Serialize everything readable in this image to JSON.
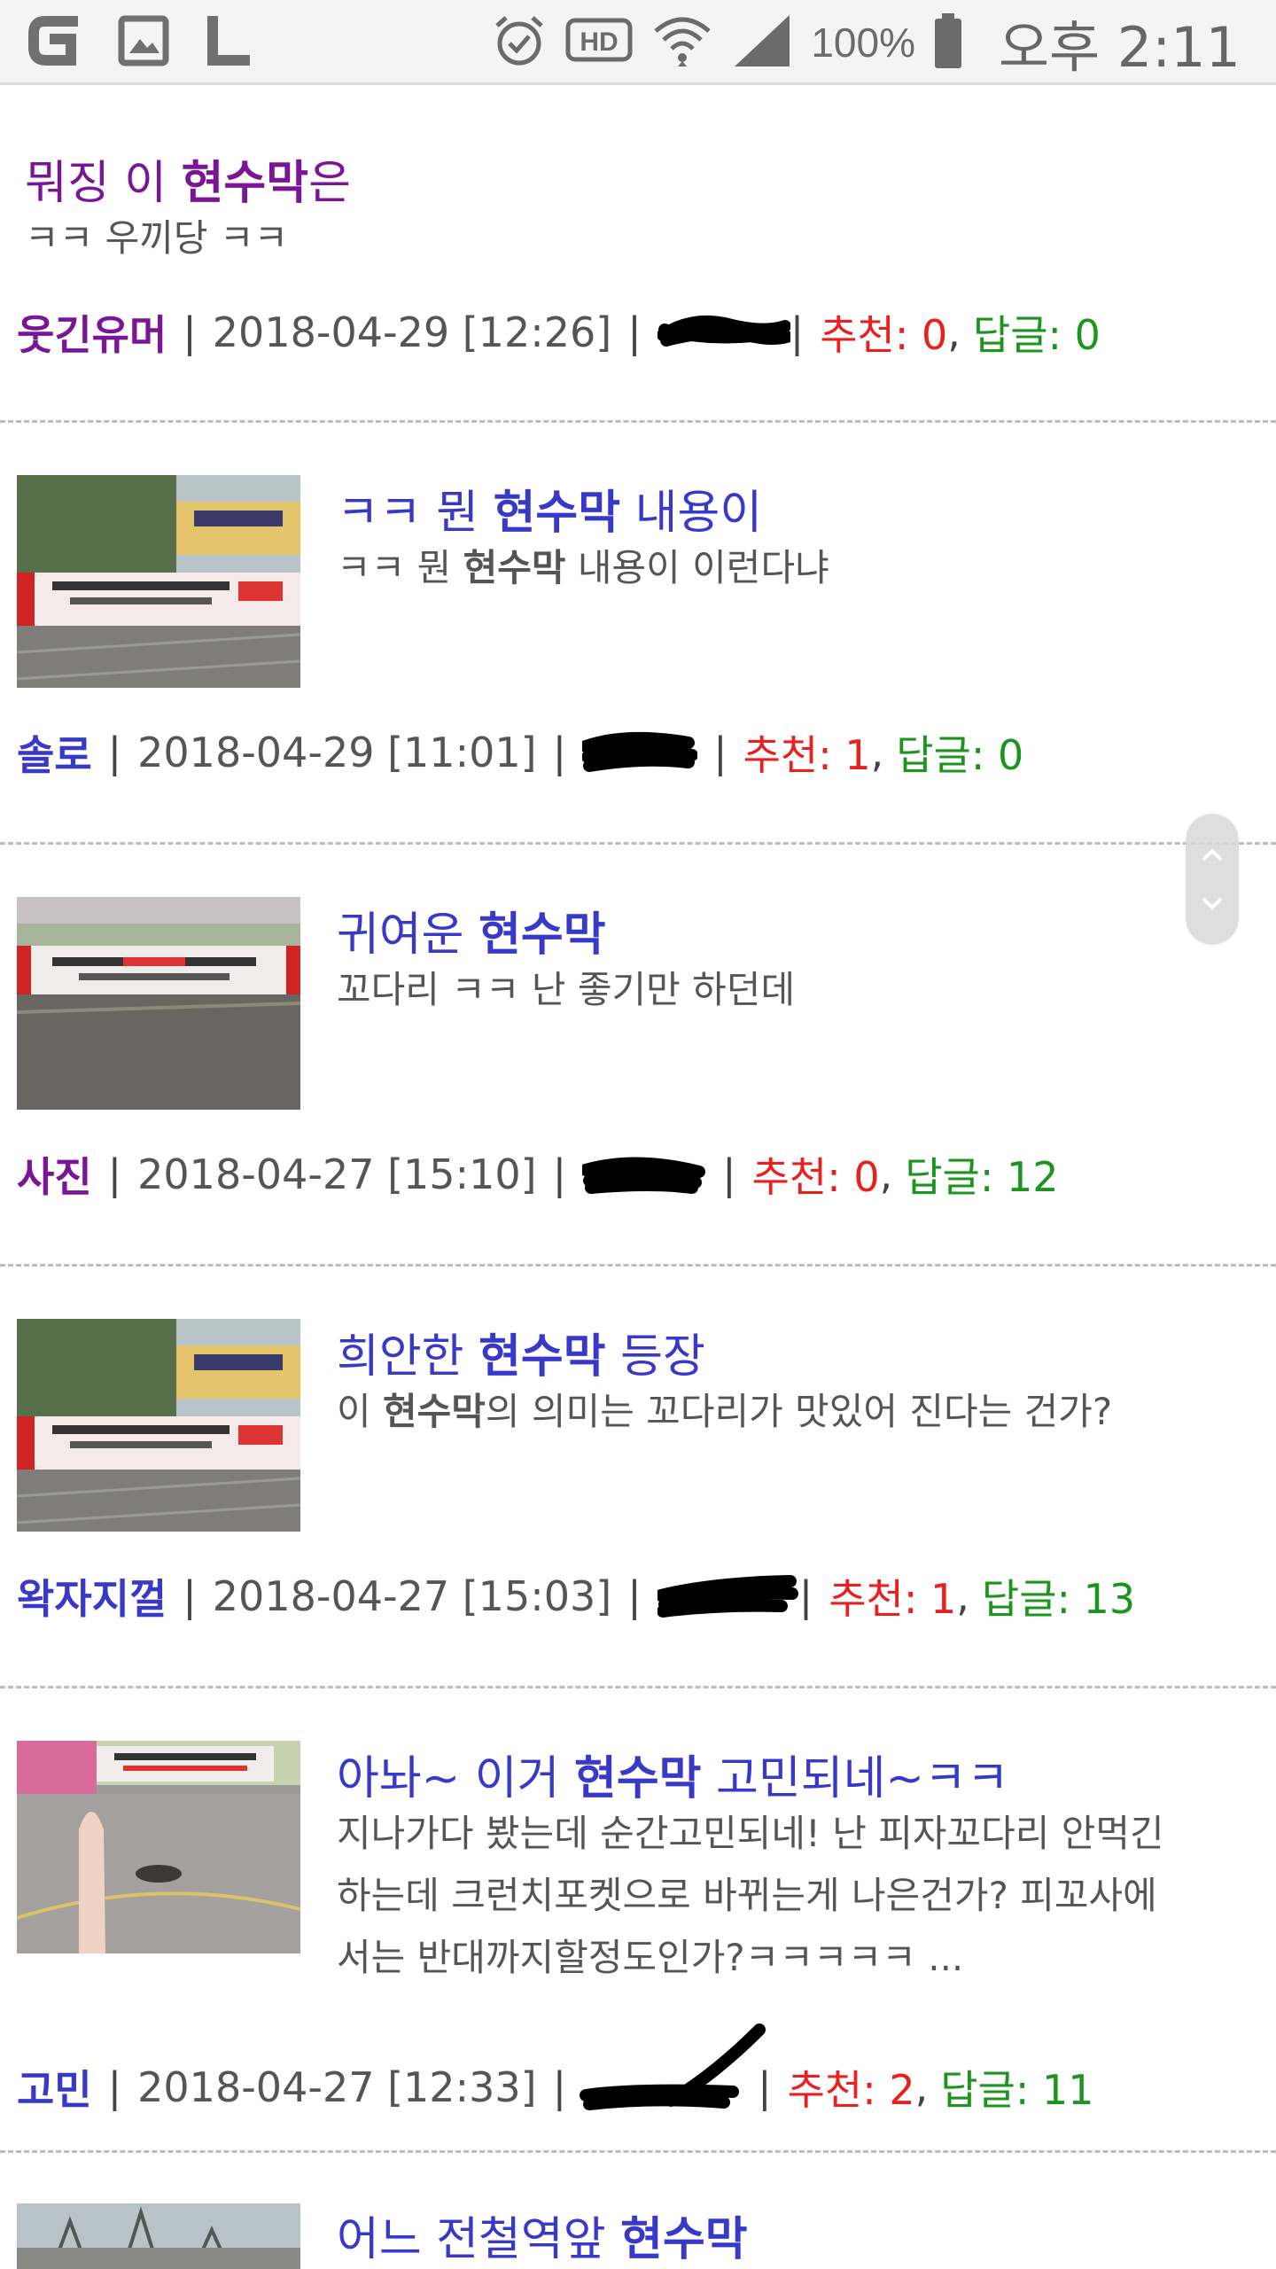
{
  "status_bar": {
    "battery": "100%",
    "time": "오후 2:11",
    "left_icons": [
      "g-app-icon",
      "gallery-icon",
      "l-app-icon"
    ],
    "right_icons": [
      "alarm-icon",
      "hd-icon",
      "wifi-icon",
      "signal-icon",
      "battery-icon"
    ]
  },
  "posts": [
    {
      "title_pre": "뭐징 이 ",
      "title_bold": "현수막",
      "title_post": "은",
      "snippet": "ㅋㅋ 우끼당 ㅋㅋ",
      "author": "웃긴유머",
      "date": "2018-04-29 [12:26]",
      "rec_label": "추천: ",
      "rec_value": "0",
      "reply_label": "답글: ",
      "reply_value": "0",
      "has_thumb": false
    },
    {
      "title_pre": "ㅋㅋ 뭔 ",
      "title_bold": "현수막",
      "title_post": " 내용이",
      "snippet_pre": "ㅋㅋ 뭔 ",
      "snippet_bold": "현수막",
      "snippet_post": " 내용이 이런다냐",
      "author": "솔로",
      "date": "2018-04-29 [11:01]",
      "rec_label": "추천: ",
      "rec_value": "1",
      "reply_label": "답글: ",
      "reply_value": "0",
      "has_thumb": true
    },
    {
      "title_pre": "귀여운 ",
      "title_bold": "현수막",
      "title_post": "",
      "snippet": "꼬다리 ㅋㅋ 난 좋기만 하던데",
      "author": "사진",
      "date": "2018-04-27 [15:10]",
      "rec_label": "추천: ",
      "rec_value": "0",
      "reply_label": "답글: ",
      "reply_value": "12",
      "has_thumb": true
    },
    {
      "title_pre": "희안한 ",
      "title_bold": "현수막",
      "title_post": " 등장",
      "snippet_pre": "이 ",
      "snippet_bold": "현수막",
      "snippet_post": "의 의미는 꼬다리가 맛있어 진다는 건가?",
      "author": "왁자지껄",
      "date": "2018-04-27 [15:03]",
      "rec_label": "추천: ",
      "rec_value": "1",
      "reply_label": "답글: ",
      "reply_value": "13",
      "has_thumb": true
    },
    {
      "title_pre": "아놔~ 이거 ",
      "title_bold": "현수막",
      "title_post": " 고민되네~ㅋㅋ",
      "snippet_line1": "지나가다 봤는데 순간고민되네! 난 피자꼬다리 안먹긴",
      "snippet_line2": "하는데 크런치포켓으로 바뀌는게 나은건가? 피꼬사에",
      "snippet_line3": "서는 반대까지할정도인가?ㅋㅋㅋㅋㅋ ...",
      "author": "고민",
      "date": "2018-04-27 [12:33]",
      "rec_label": "추천: ",
      "rec_value": "2",
      "reply_label": "답글: ",
      "reply_value": "11",
      "has_thumb": true
    },
    {
      "title_pre": "어느 전철역앞 ",
      "title_bold": "현수막",
      "title_post": "",
      "has_thumb": true
    }
  ],
  "colors": {
    "title": "#3838c9",
    "visited": "#7a1596",
    "recommend": "#e8201f",
    "reply": "#1d9320"
  }
}
